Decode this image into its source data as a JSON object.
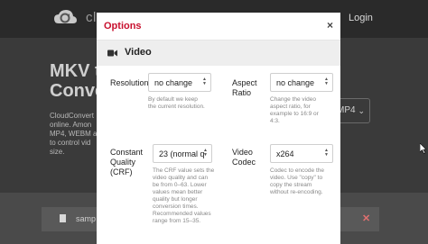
{
  "background": {
    "brand": "clo",
    "login": "Login",
    "hero_title_1": "MKV to",
    "hero_title_2": "Conver",
    "hero_desc": [
      "CloudConvert",
      "online. Amon",
      "MP4, WEBM a",
      "to control vid",
      "size."
    ],
    "format_select": "MP4",
    "file_name": "samp"
  },
  "modal": {
    "title": "Options",
    "close": "×",
    "section": "Video",
    "fields": {
      "resolution": {
        "label": [
          "Resolution"
        ],
        "value": "no change",
        "help": [
          "By default we keep",
          "the current resolution."
        ]
      },
      "aspect_ratio": {
        "label": [
          "Aspect",
          "Ratio"
        ],
        "value": "no change",
        "help": [
          "Change the video",
          "aspect ratio, for",
          "example to 16:9 or",
          "4:3."
        ]
      },
      "crf": {
        "label": [
          "Constant",
          "Quality",
          "(CRF)"
        ],
        "value": "23 (normal q",
        "help": [
          "The CRF value sets the",
          "video quality and can",
          "be from 0–63. Lower",
          "values mean better",
          "quality but longer",
          "conversion times.",
          "Recommended values",
          "range from 15–35."
        ]
      },
      "video_codec": {
        "label": [
          "Video",
          "Codec"
        ],
        "value": "x264",
        "help": [
          "Codec to encode the",
          "video. Use \"copy\" to",
          "copy the stream",
          "without re-encoding."
        ]
      }
    }
  },
  "colors": {
    "accent": "#c8102e",
    "overlay_bg": "#3a3a3a",
    "modal_bg": "#ffffff",
    "section_bg": "#eeeeee"
  },
  "icons": {
    "logo": "cloud-logo-icon",
    "section": "video-camera-icon",
    "file": "file-icon",
    "remove": "close-icon",
    "cursor": "mouse-cursor-icon"
  }
}
